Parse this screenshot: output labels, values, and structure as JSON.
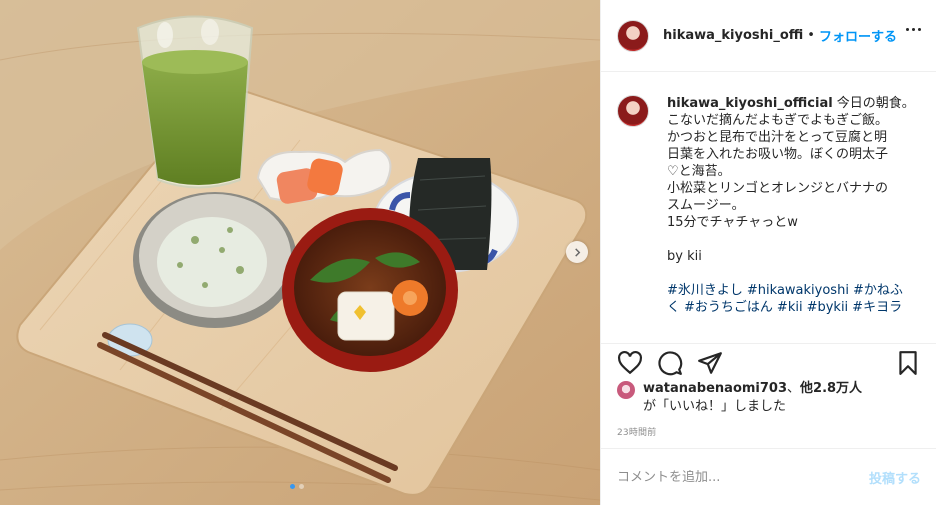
{
  "post": {
    "username_short": "hikawa_kiyoshi_offi",
    "separator": "•",
    "follow_label": "フォローする",
    "more_icon": "more-horizontal-icon"
  },
  "caption": {
    "username": "hikawa_kiyoshi_official",
    "lines": [
      "今日の朝食。",
      "こないだ摘んだよもぎでよもぎご飯。",
      "かつおと昆布で出汁をとって豆腐と明",
      "日葉を入れたお吸い物。ぼくの明太子",
      "♡と海苔。",
      "小松菜とリンゴとオレンジとバナナの",
      "スムージー。",
      "15分でチャチャっとw",
      "",
      "by kii"
    ],
    "hashtags_line1": [
      "#氷川きよし",
      "#hikawakiyoshi",
      "#かねふ"
    ],
    "hashtags_line2": [
      "く",
      "#おうちごはん",
      "#kii",
      "#bykii",
      "#キヨラ"
    ]
  },
  "actions": {
    "like_icon": "heart-icon",
    "comment_icon": "comment-bubble-icon",
    "share_icon": "paper-plane-icon",
    "save_icon": "bookmark-icon"
  },
  "likes": {
    "user": "watanabenaomi703",
    "others": "他2.8万人",
    "line2": "が「いいね！」しました"
  },
  "timestamp": "23時間前",
  "comment": {
    "placeholder": "コメントを追加...",
    "post_label": "投稿する"
  },
  "carousel": {
    "next_icon": "chevron-right-icon",
    "dots": 2,
    "active_dot": 0
  },
  "colors": {
    "link_blue": "#0095f6",
    "hashtag": "#00376b",
    "disabled_post": "#b2dffc",
    "active_dot": "#3897f0"
  }
}
